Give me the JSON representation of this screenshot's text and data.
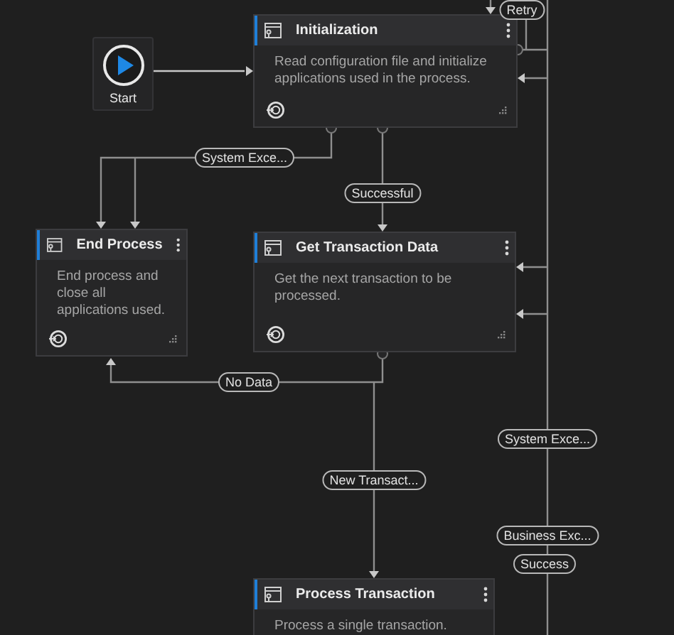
{
  "start": {
    "label": "Start"
  },
  "states": [
    {
      "title": "Initialization",
      "description": "Read configuration file and initialize applications used in the process."
    },
    {
      "title": "End Process",
      "description": "End process and close all applications used."
    },
    {
      "title": "Get Transaction Data",
      "description": "Get the next transaction to be processed."
    },
    {
      "title": "Process Transaction",
      "description": "Process a single transaction."
    }
  ],
  "transitions": [
    {
      "label": "Retry"
    },
    {
      "label": "System Exce..."
    },
    {
      "label": "Successful"
    },
    {
      "label": "No Data"
    },
    {
      "label": "New Transact..."
    },
    {
      "label": "System Exce..."
    },
    {
      "label": "Business Exc..."
    },
    {
      "label": "Success"
    }
  ]
}
